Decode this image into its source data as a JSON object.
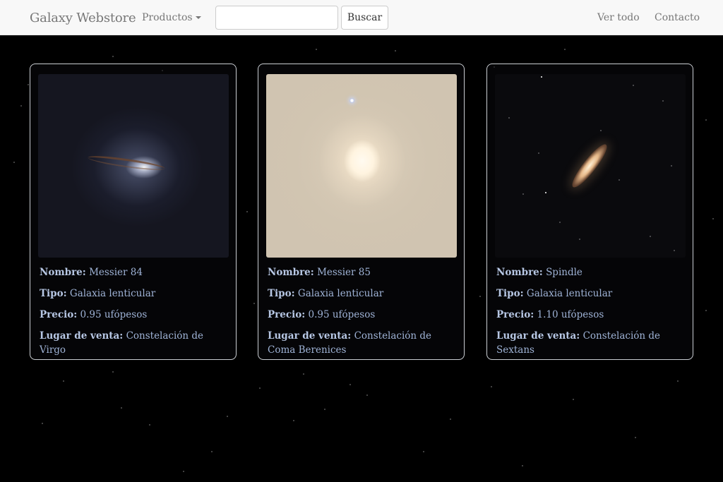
{
  "navbar": {
    "brand": "Galaxy Webstore",
    "dropdown_label": "Productos",
    "search": {
      "value": "",
      "placeholder": ""
    },
    "search_button": "Buscar",
    "links": [
      "Ver todo",
      "Contacto"
    ]
  },
  "labels": {
    "name": "Nombre:",
    "type": "Tipo:",
    "price": "Precio:",
    "place": "Lugar de venta:"
  },
  "products": [
    {
      "name": "Messier 84",
      "type": "Galaxia lenticular",
      "price": "0.95 ufópesos",
      "place": "Constelación de Virgo"
    },
    {
      "name": "Messier 85",
      "type": "Galaxia lenticular",
      "price": "0.95 ufópesos",
      "place": "Constelación de Coma Berenices"
    },
    {
      "name": "Spindle",
      "type": "Galaxia lenticular",
      "price": "1.10 ufópesos",
      "place": "Constelación de Sextans"
    }
  ]
}
